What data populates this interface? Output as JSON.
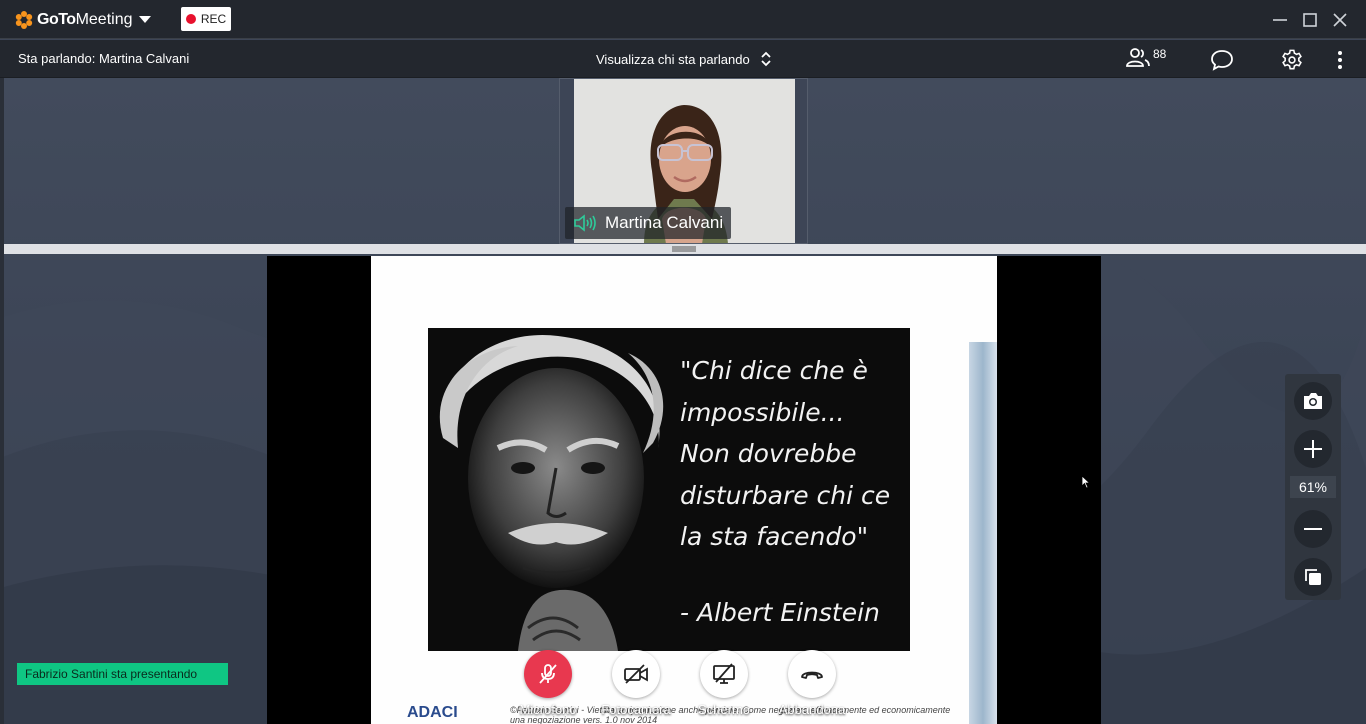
{
  "app": {
    "brand_bold": "GoTo",
    "brand_regular": "Meeting",
    "rec_label": "REC"
  },
  "colors": {
    "accent_orange": "#f7941d",
    "rec_red": "#e8112d",
    "mic_muted_red": "#e8384f",
    "presenting_green": "#0fc683",
    "audio_green": "#2ecc9a"
  },
  "subbar": {
    "speaking_label": "Sta parlando: Martina Calvani",
    "view_mode_label": "Visualizza chi sta parlando",
    "attendee_count": "88"
  },
  "icons": {
    "logo": "gotomeeting-logo-icon",
    "dropdown": "chevron-down-icon",
    "view_mode": "sort-updown-icon",
    "attendees": "people-icon",
    "chat": "chat-bubble-icon",
    "settings": "gear-icon",
    "more": "more-vertical-icon",
    "speaker": "speaker-volume-icon"
  },
  "webcam": {
    "participant_name": "Martina Calvani"
  },
  "slide": {
    "quote_lines": [
      "\"Chi dice che è",
      "impossibile...",
      "Non dovrebbe",
      "disturbare chi ce",
      "la sta facendo\""
    ],
    "author": "- Albert Einstein",
    "footer_logo": "ADACI",
    "footer_text": "©Fabrizio Santini - Vietata la riproduzione anche parziale. Come negoziare efficacemente ed economicamente una negoziazione vers. 1.0 nov 2014"
  },
  "zoom": {
    "level": "61%"
  },
  "presenting_label": "Fabrizio Santini sta presentando",
  "controls": {
    "microphone": "Microfono",
    "camera": "Fotocamera",
    "screen": "Schermo",
    "leave": "Abbandona"
  }
}
